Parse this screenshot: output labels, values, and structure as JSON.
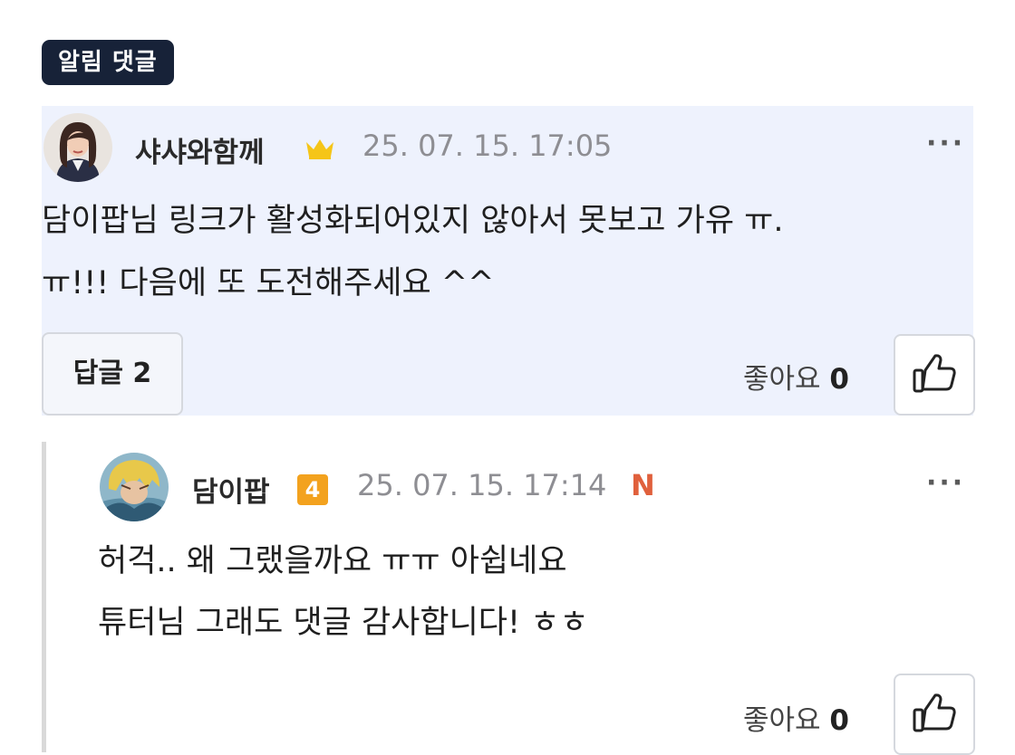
{
  "section_badge": "알림 댓글",
  "comments": [
    {
      "author": "샤샤와함께",
      "date": "25. 07. 15. 17:05",
      "lines": [
        "담이팝님 링크가 활성화되어있지 않아서 못보고 가유 ㅠ.",
        "ㅠ!!! 다음에 또 도전해주세요 ^^"
      ],
      "reply_button": "답글 2",
      "like_label": "좋아요",
      "like_count": "0",
      "more": "···"
    },
    {
      "author": "담이팝",
      "level": "4",
      "date": "25. 07. 15. 17:14",
      "new_badge": "N",
      "lines": [
        "허걱.. 왜 그랬을까요 ㅠㅠ 아쉽네요",
        "튜터님 그래도 댓글 감사합니다! ㅎㅎ"
      ],
      "like_label": "좋아요",
      "like_count": "0",
      "more": "···"
    }
  ],
  "colors": {
    "highlight_bg": "#eef2fd",
    "badge_bg": "#172238",
    "crown": "#f5c518",
    "level_badge": "#f3a21e",
    "new_badge": "#e0603c"
  }
}
